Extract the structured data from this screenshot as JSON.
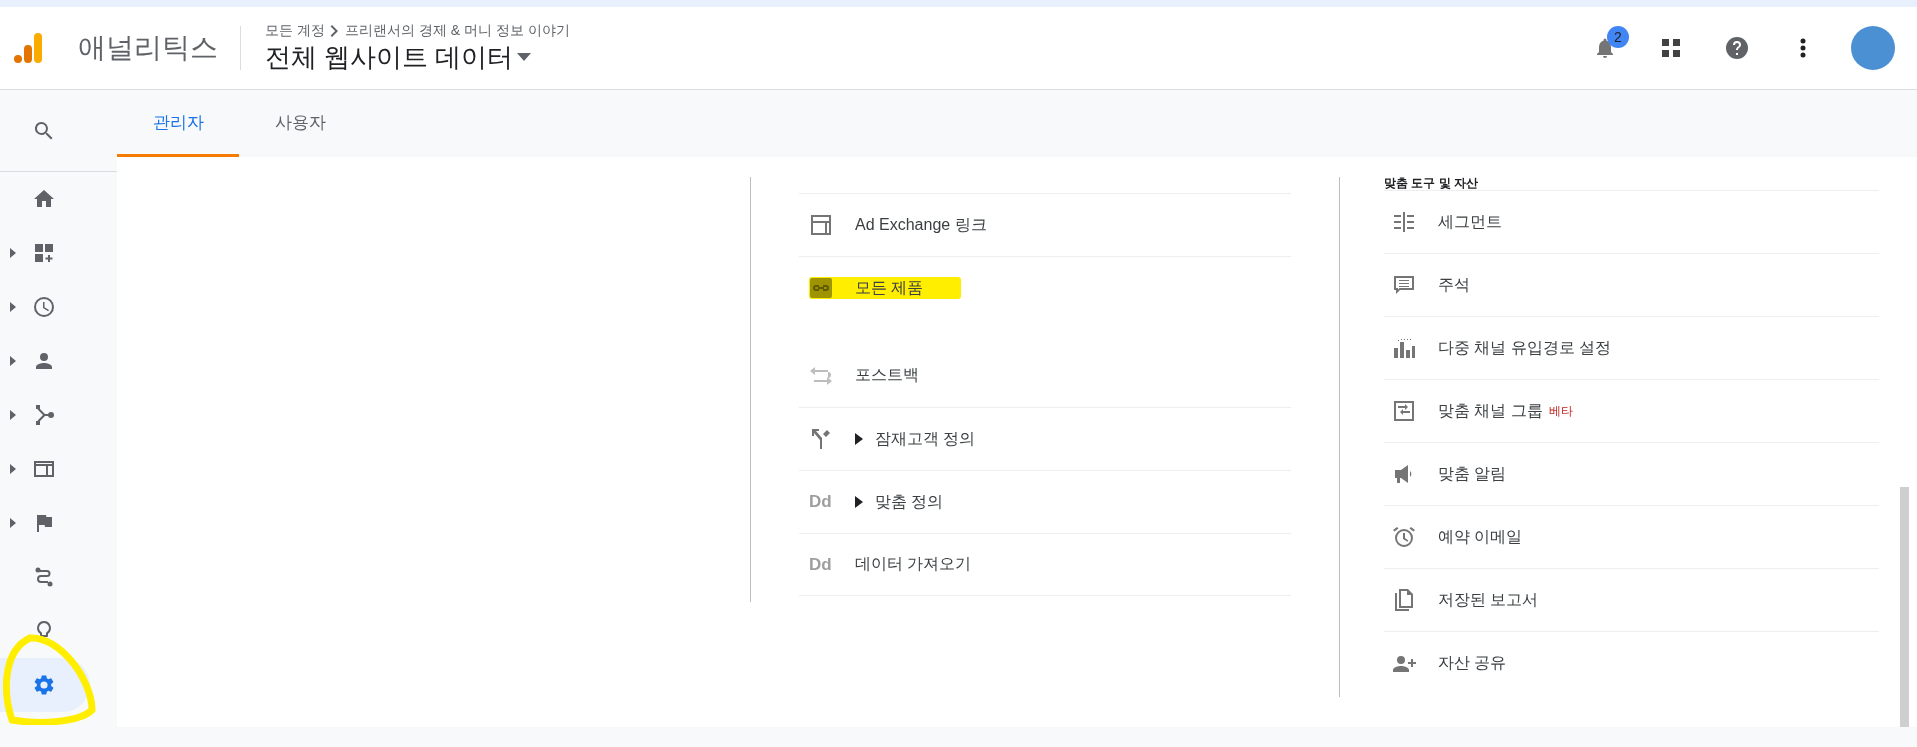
{
  "header": {
    "app_name": "애널리틱스",
    "breadcrumb": [
      "모든 계정",
      "프리랜서의 경제 & 머니 정보 이야기"
    ],
    "view_title": "전체 웹사이트 데이터",
    "notification_count": "2"
  },
  "sidebar": {
    "items": [
      {
        "kind": "search",
        "expandable": false,
        "selected": false,
        "circled": false
      },
      {
        "kind": "home",
        "expandable": false,
        "selected": false,
        "circled": false
      },
      {
        "kind": "dashboard",
        "expandable": true,
        "selected": false,
        "circled": false
      },
      {
        "kind": "clock",
        "expandable": true,
        "selected": false,
        "circled": false
      },
      {
        "kind": "person",
        "expandable": true,
        "selected": false,
        "circled": false
      },
      {
        "kind": "fork",
        "expandable": true,
        "selected": false,
        "circled": false
      },
      {
        "kind": "window",
        "expandable": true,
        "selected": false,
        "circled": false
      },
      {
        "kind": "flag",
        "expandable": true,
        "selected": false,
        "circled": false
      },
      {
        "kind": "route",
        "expandable": false,
        "selected": false,
        "circled": false
      },
      {
        "kind": "bulb",
        "expandable": false,
        "selected": false,
        "circled": false
      },
      {
        "kind": "gear",
        "expandable": false,
        "selected": true,
        "circled": true
      }
    ]
  },
  "tabs": [
    {
      "label": "관리자",
      "selected": true
    },
    {
      "label": "사용자",
      "selected": false
    }
  ],
  "middle_column": {
    "items": [
      {
        "kind": "panel",
        "label": "Ad Exchange 링크",
        "expandable": false,
        "highlighted": false
      },
      {
        "kind": "link",
        "label": "모든 제품",
        "expandable": false,
        "highlighted": true
      },
      {
        "kind": "arrows",
        "label": "포스트백",
        "expandable": false,
        "highlighted": false
      },
      {
        "kind": "split",
        "label": "잠재고객 정의",
        "expandable": true,
        "highlighted": false
      },
      {
        "kind": "text",
        "icon_text": "Dd",
        "label": "맞춤 정의",
        "expandable": true,
        "highlighted": false
      },
      {
        "kind": "text",
        "icon_text": "Dd",
        "label": "데이터 가져오기",
        "expandable": false,
        "highlighted": false
      }
    ]
  },
  "right_column": {
    "heading": "맞춤 도구 및 자산",
    "items": [
      {
        "kind": "segment",
        "label": "세그먼트"
      },
      {
        "kind": "comment",
        "label": "주석"
      },
      {
        "kind": "bars",
        "label": "다중 채널 유입경로 설정"
      },
      {
        "kind": "channels",
        "label": "맞춤 채널 그룹",
        "badge": "베타"
      },
      {
        "kind": "megaphone",
        "label": "맞춤 알림"
      },
      {
        "kind": "alarm",
        "label": "예약 이메일"
      },
      {
        "kind": "copies",
        "label": "저장된 보고서"
      },
      {
        "kind": "person-add",
        "label": "자산 공유"
      }
    ]
  }
}
